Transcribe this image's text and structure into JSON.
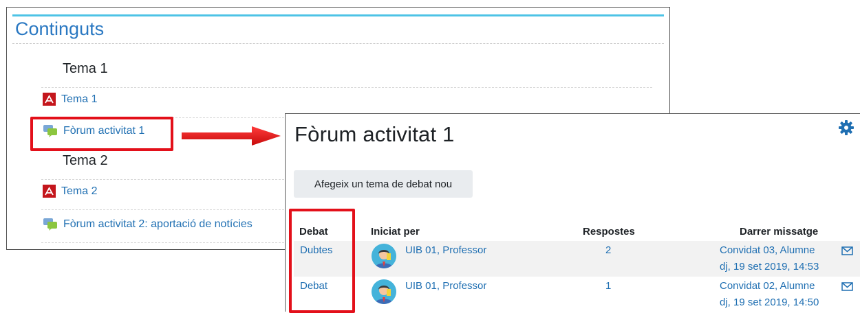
{
  "contents": {
    "heading": "Continguts",
    "sections": [
      {
        "title": "Tema 1",
        "activities": [
          {
            "type": "pdf",
            "icon": "pdf-icon",
            "label": "Tema 1"
          },
          {
            "type": "forum",
            "icon": "forum-icon",
            "label": "Fòrum activitat 1"
          }
        ]
      },
      {
        "title": "Tema 2",
        "activities": [
          {
            "type": "pdf",
            "icon": "pdf-icon",
            "label": "Tema 2"
          },
          {
            "type": "forum",
            "icon": "forum-icon",
            "label": "Fòrum activitat 2: aportació de notícies"
          }
        ]
      }
    ]
  },
  "forum": {
    "title": "Fòrum activitat 1",
    "gear_icon": "gear-icon",
    "add_button": "Afegeix un tema de debat nou",
    "columns": {
      "discussion": "Debat",
      "started_by": "Iniciat per",
      "replies": "Respostes",
      "last_post": "Darrer missatge"
    },
    "rows": [
      {
        "discussion": "Dubtes",
        "started_by": "UIB 01, Professor",
        "replies": "2",
        "last_post_author": "Convidat 03, Alumne",
        "last_post_date": "dj, 19 set 2019, 14:53"
      },
      {
        "discussion": "Debat",
        "started_by": "UIB 01, Professor",
        "replies": "1",
        "last_post_author": "Convidat 02, Alumne",
        "last_post_date": "dj, 19 set 2019, 14:50"
      }
    ]
  },
  "colors": {
    "link": "#1f6fb2",
    "highlight": "#e3101a",
    "accent_bar": "#4dc3e6",
    "pdf": "#c4161c"
  }
}
